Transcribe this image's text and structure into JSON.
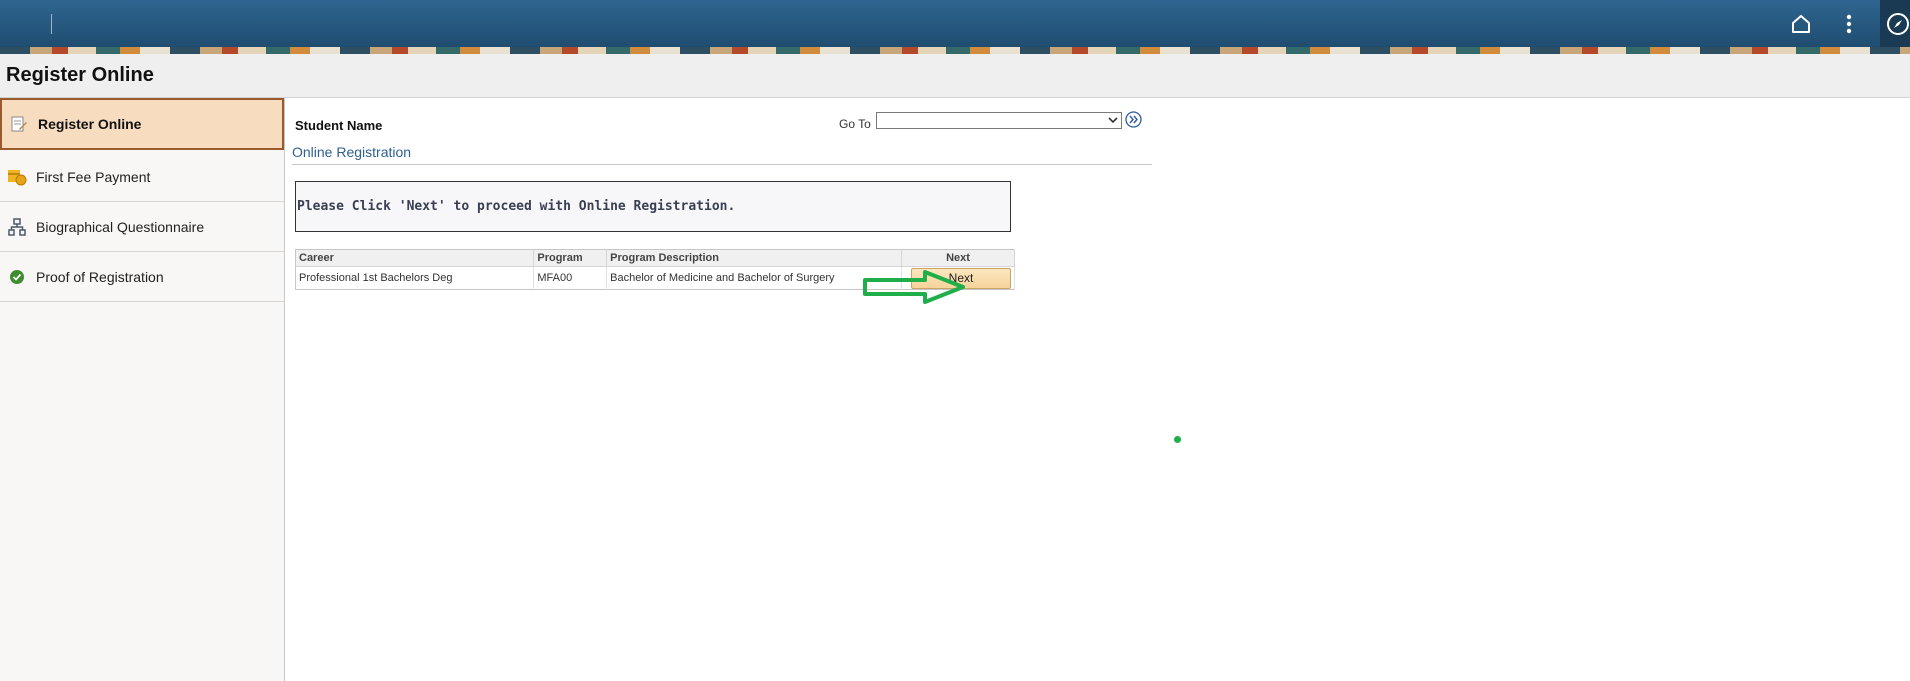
{
  "page": {
    "title": "Register Online"
  },
  "topbar": {
    "icons": [
      "home-icon",
      "more-vertical-icon",
      "navigator-compass-icon"
    ]
  },
  "sidebar": {
    "items": [
      {
        "label": "Register Online",
        "icon": "edit-document-icon",
        "active": true
      },
      {
        "label": "First Fee Payment",
        "icon": "payment-icon",
        "active": false
      },
      {
        "label": "Biographical Questionnaire",
        "icon": "org-chart-icon",
        "active": false
      },
      {
        "label": "Proof of Registration",
        "icon": "check-circle-icon",
        "active": false
      }
    ]
  },
  "main": {
    "student_name_label": "Student Name",
    "goto_label": "Go To",
    "goto_value": "",
    "section_title": "Online Registration",
    "notice": "Please Click 'Next' to proceed with Online Registration.",
    "grid": {
      "headers": [
        "Career",
        "Program",
        "Program Description",
        "Next"
      ],
      "rows": [
        {
          "career": "Professional 1st Bachelors Deg",
          "program": "MFA00",
          "description": "Bachelor of Medicine and Bachelor of Surgery",
          "next_label": "Next"
        }
      ]
    }
  },
  "colors": {
    "header_bar": "#2f6590",
    "active_item_bg": "#f8dcc0",
    "active_item_border": "#9a5a2e",
    "section_title": "#2f5f8f",
    "annotation": "#1fae4a"
  }
}
